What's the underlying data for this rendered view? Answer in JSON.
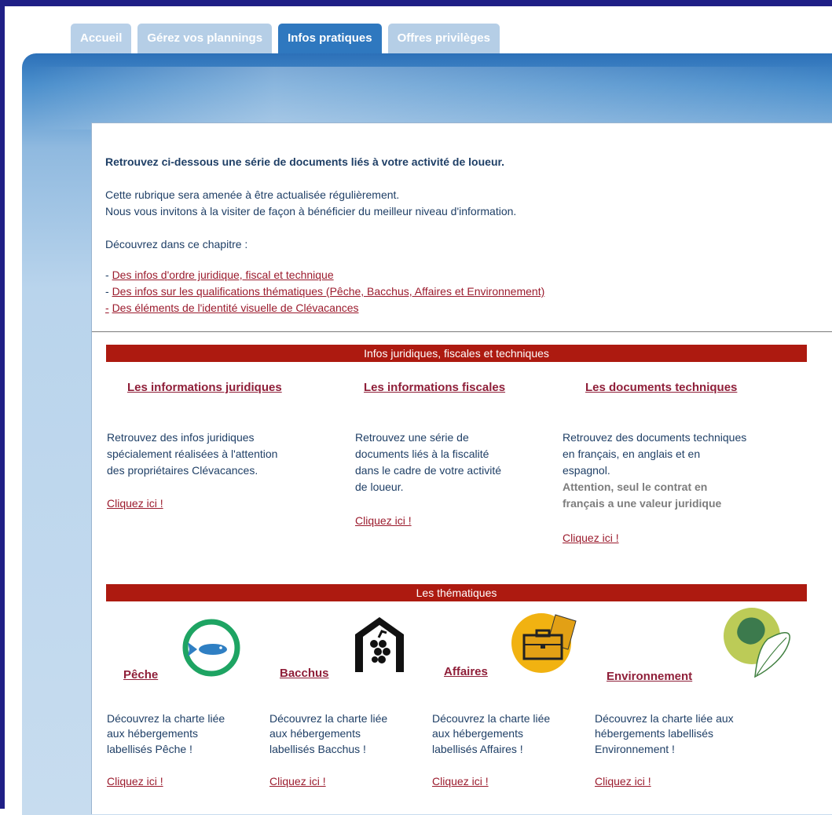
{
  "tabs": [
    {
      "label": "Accueil"
    },
    {
      "label": "Gérez vos plannings"
    },
    {
      "label": "Infos pratiques"
    },
    {
      "label": "Offres privilèges"
    }
  ],
  "intro": {
    "title": "Retrouvez ci-dessous une série de documents liés à votre activité de loueur.",
    "line1": "Cette rubrique sera amenée à être actualisée régulièrement.",
    "line2": "Nous vous invitons à la visiter de façon à bénéficier du meilleur niveau d'information.",
    "chapter": "Découvrez dans ce chapitre :",
    "dash": "-",
    "links": [
      "Des infos d'ordre juridique, fiscal et technique",
      "Des infos sur les qualifications thématiques (Pêche, Bacchus, Affaires et Environnement)",
      "Des éléments de l'identité visuelle de Clévacances"
    ]
  },
  "section1": {
    "header": "Infos juridiques, fiscales et techniques",
    "columns": [
      {
        "title": "Les informations juridiques",
        "lines": [
          "Retrouvez des infos juridiques",
          "spécialement réalisées à l'attention",
          "des propriétaires Clévacances."
        ],
        "cta": "Cliquez ici !"
      },
      {
        "title": "Les informations fiscales",
        "lines": [
          "Retrouvez une série de",
          "documents liés à la fiscalité",
          "dans le cadre de votre activité",
          "de loueur."
        ],
        "cta": "Cliquez ici !"
      },
      {
        "title": "Les documents techniques",
        "lines": [
          "Retrouvez des documents techniques",
          "en français, en anglais et en",
          "espagnol."
        ],
        "warning": [
          "Attention, seul le contrat en",
          "français a une valeur juridique"
        ],
        "cta": "Cliquez ici !"
      }
    ]
  },
  "section2": {
    "header": "Les thématiques",
    "themes": [
      {
        "title": "Pêche",
        "lines": [
          "Découvrez la charte liée",
          "aux hébergements",
          "labellisés Pêche !"
        ],
        "cta": "Cliquez ici !",
        "icon": "fish-icon"
      },
      {
        "title": "Bacchus",
        "lines": [
          "Découvrez la charte liée",
          "aux hébergements",
          "labellisés Bacchus !"
        ],
        "cta": "Cliquez ici !",
        "icon": "grapes-house-icon"
      },
      {
        "title": "Affaires",
        "lines": [
          "Découvrez la charte liée",
          "aux hébergements",
          "labellisés Affaires !"
        ],
        "cta": "Cliquez ici !",
        "icon": "briefcase-icon"
      },
      {
        "title": "Environnement",
        "lines": [
          "Découvrez la charte liée aux",
          "hébergements labellisés",
          "Environnement !"
        ],
        "cta": "Cliquez ici !",
        "icon": "leaf-icon"
      }
    ]
  },
  "colors": {
    "frame": "#1f1f86",
    "tab_active": "#2f78bf",
    "tab_inactive": "#b5cee6",
    "section_bar": "#ad1a10",
    "link": "#9b1b2d",
    "text": "#1f3f66"
  }
}
